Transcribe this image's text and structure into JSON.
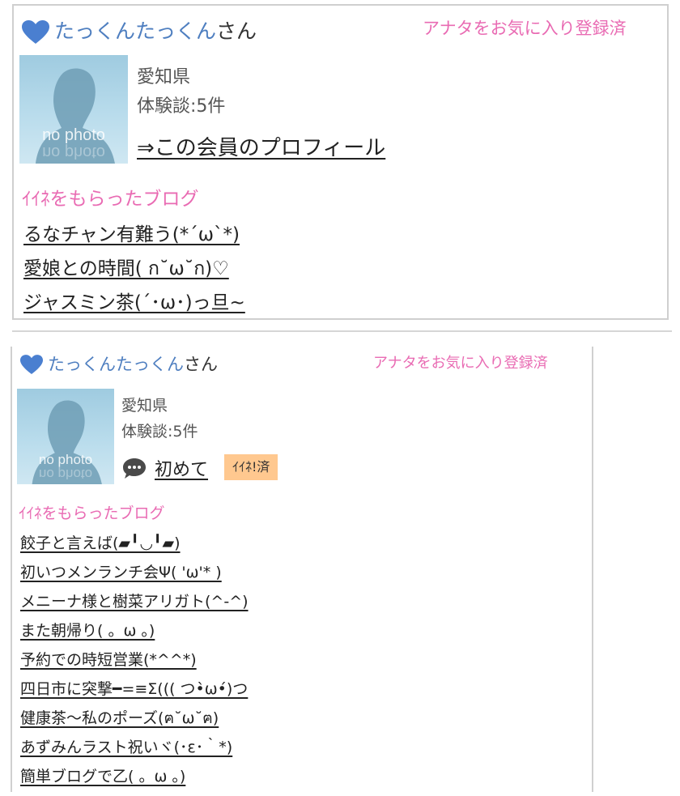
{
  "card1": {
    "name": "たっくんたっくん",
    "san": "さん",
    "favorite": "アナタをお気に入り登録済",
    "photo_text": "no photo",
    "prefecture": "愛知県",
    "reviews": "体験談:5件",
    "profile_link": "⇒この会員のプロフィール",
    "liked_heading": "ｲｲﾈをもらったブログ",
    "blogs": [
      "るなチャン有難う(*´ω`*)",
      "愛娘との時間( ก˘ω˘ก)♡",
      "ジャスミン茶(´･ω･)っ旦~"
    ]
  },
  "card2": {
    "name": "たっくんたっくん",
    "san": "さん",
    "favorite": "アナタをお気に入り登録済",
    "photo_text": "no photo",
    "prefecture": "愛知県",
    "reviews": "体験談:5件",
    "first_link": "初めて",
    "badge": "ｲｲﾈ!済",
    "liked_heading": "ｲｲﾈをもらったブログ",
    "blogs": [
      "餃子と言えば(▰╹◡╹▰)",
      "初いつメンランチ会Ψ( 'ω'* )",
      "メニーナ様と樹菜アリガト(^-^)",
      "また朝帰り( 。ω 。)",
      "予約での時短営業(*^^*)",
      "四日市に突撃━=≡Σ((( つ•̀ω•́)つ",
      "健康茶〜私のポーズ(ฅ˘ω˘ฅ)",
      "あずみんラスト祝いヾ(･ε･｀*)",
      "簡単ブログで乙( 。ω 。)"
    ]
  },
  "colors": {
    "name": "#4f7fc0",
    "pink": "#e96bb3",
    "badge": "#ffc88f",
    "heart": "#4a7fd0"
  }
}
